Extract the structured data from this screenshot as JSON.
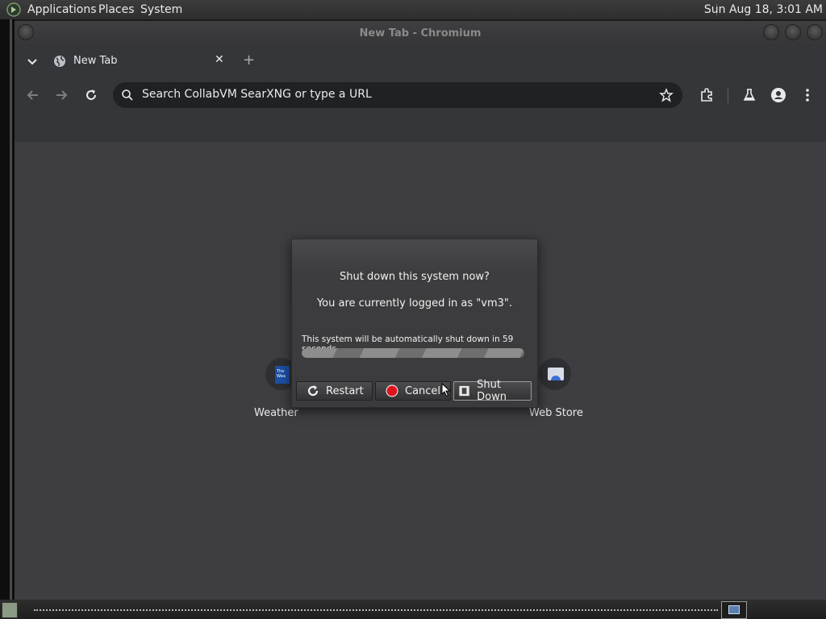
{
  "top_panel": {
    "menus": [
      "Applications",
      "Places",
      "System"
    ],
    "clock": "Sun Aug 18,  3:01 AM"
  },
  "window": {
    "title": "New Tab - Chromium"
  },
  "browser": {
    "tab_title": "New Tab",
    "tab_close": "✕",
    "new_tab": "+",
    "omnibox_placeholder": "Search CollabVM SearXNG or type a URL",
    "shortcuts": [
      {
        "label": "Weather",
        "icon": "weather-channel-icon"
      },
      {
        "label": "Web Store",
        "icon": "web-store-icon"
      }
    ]
  },
  "dialog": {
    "question": "Shut down this system now?",
    "logged_in": "You are currently logged in as \"vm3\".",
    "auto_shutdown": "This system will be automatically shut down in 59 seconds",
    "progress": 1.0,
    "buttons": {
      "restart": "Restart",
      "cancel": "Cancel",
      "shutdown": "Shut Down"
    }
  },
  "colors": {
    "dialog_bg": "#3d3d3f",
    "content_bg": "#3e3e42",
    "cancel_dot": "#e0141e"
  }
}
